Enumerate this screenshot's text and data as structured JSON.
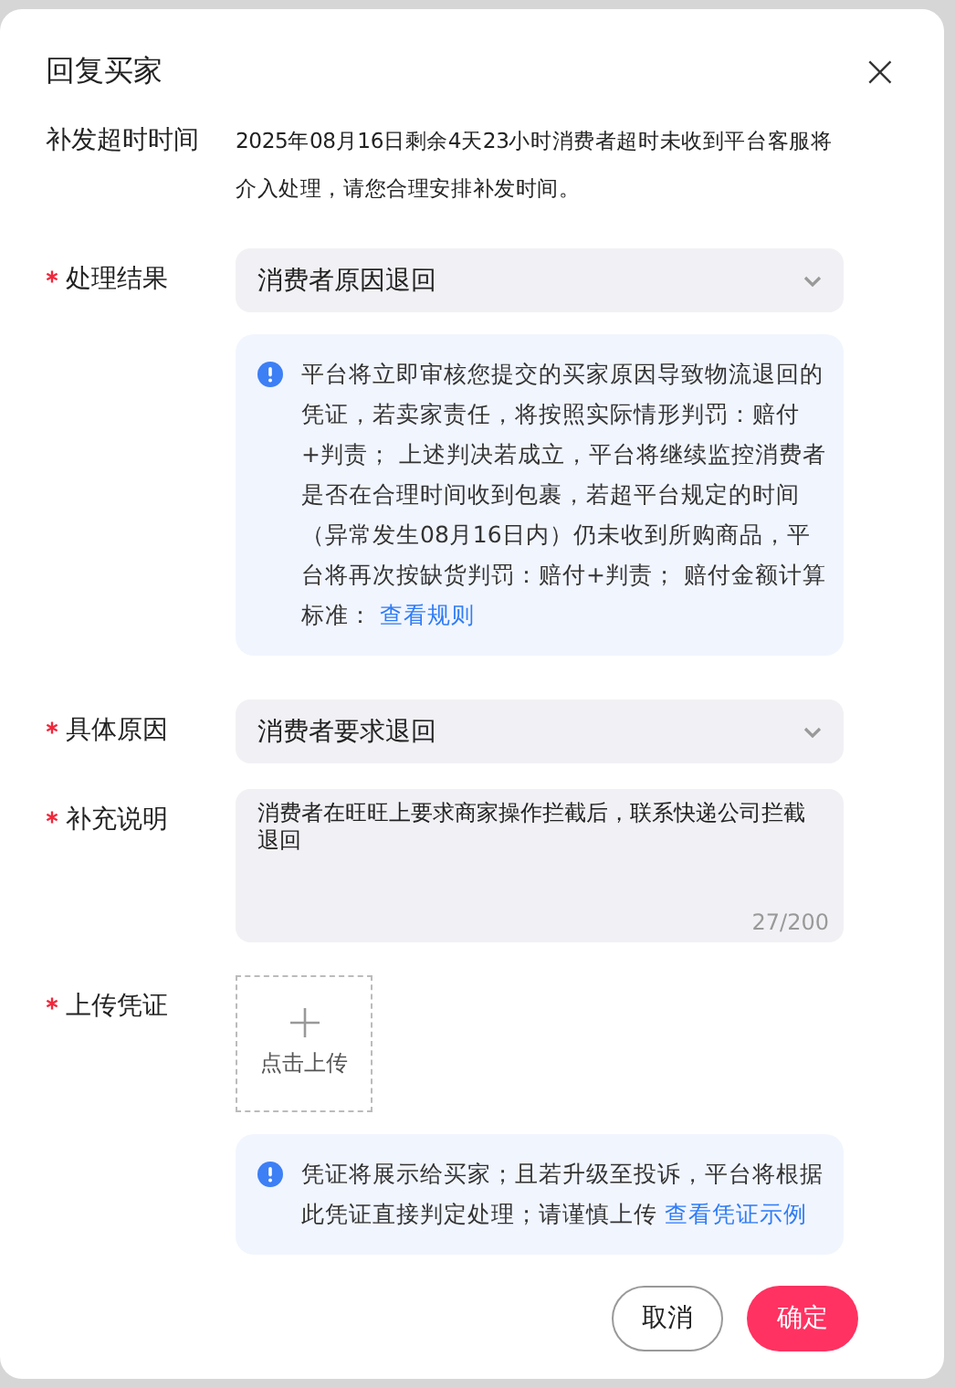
{
  "dialog": {
    "title": "回复买家",
    "close": "×"
  },
  "deadline": {
    "label": "补发超时时间",
    "text": "2025年08月16日剩余4天23小时消费者超时未收到平台客服将介入处理，请您合理安排补发时间。"
  },
  "fields": [
    {
      "kind": "select",
      "label": "处理结果",
      "required": true,
      "value": "消费者原因退回",
      "notice": {
        "text": "平台将立即审核您提交的买家原因导致物流退回的凭证，若卖家责任，将按照实际情形判罚：赔付+判责； 上述判决若成立，平台将继续监控消费者是否在合理时间收到包裹，若超平台规定的时间（异常发生08月16日内）仍未收到所购商品，平台将再次按缺货判罚：赔付+判责； 赔付金额计算标准：",
        "link": "查看规则"
      }
    },
    {
      "kind": "select",
      "label": "具体原因",
      "required": true,
      "value": "消费者要求退回"
    },
    {
      "kind": "textarea",
      "label": "补充说明",
      "required": true,
      "value": "消费者在旺旺上要求商家操作拦截后，联系快递公司拦截退回",
      "counter": "27/200"
    },
    {
      "kind": "upload",
      "label": "上传凭证",
      "required": true,
      "button": "点击上传",
      "notice": {
        "text": "凭证将展示给买家；且若升级至投诉，平台将根据此凭证直接判定处理；请谨慎上传",
        "link": "查看凭证示例"
      }
    }
  ],
  "buttons": [
    {
      "label": "取消",
      "kind": "secondary"
    },
    {
      "label": "确定",
      "kind": "primary"
    }
  ]
}
